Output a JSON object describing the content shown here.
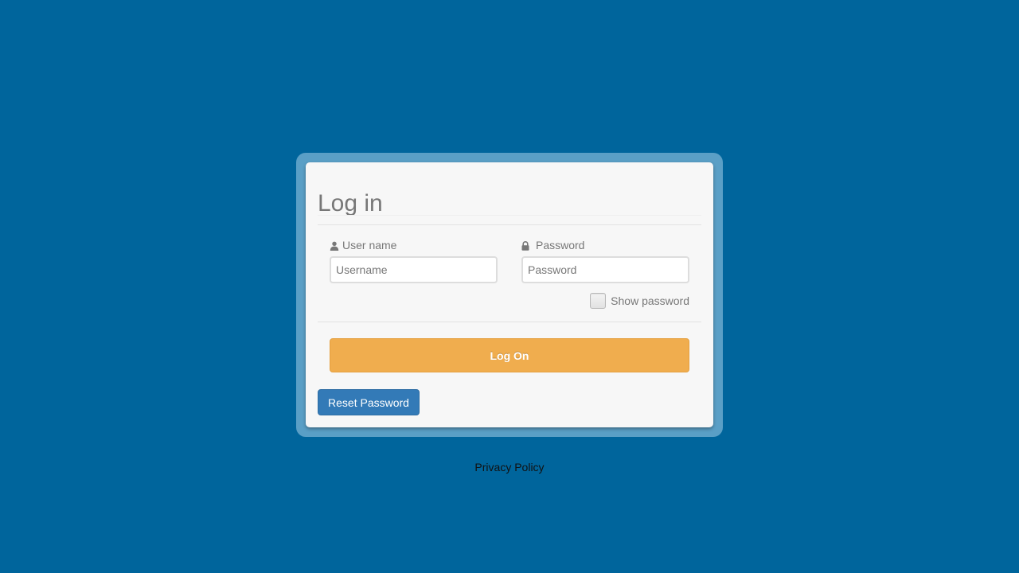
{
  "colors": {
    "background": "#00659c",
    "frame": "#5a9fc6",
    "card": "#f7f7f7",
    "logon_button": "#f0ad4e",
    "reset_button": "#337ab7"
  },
  "login": {
    "title": "Log in",
    "username": {
      "label": "User name",
      "icon": "user-icon",
      "placeholder": "Username",
      "value": ""
    },
    "password": {
      "label": "Password",
      "icon": "lock-icon",
      "placeholder": "Password",
      "value": ""
    },
    "show_password": {
      "label": "Show password",
      "checked": false
    },
    "logon_label": "Log On",
    "reset_label": "Reset Password"
  },
  "footer": {
    "privacy_label": "Privacy Policy"
  }
}
